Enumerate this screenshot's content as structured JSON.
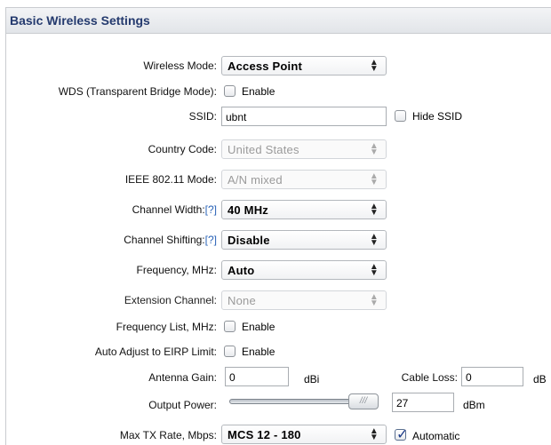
{
  "panel": {
    "title": "Basic Wireless Settings"
  },
  "wireless_mode": {
    "label": "Wireless Mode:",
    "value": "Access Point"
  },
  "wds": {
    "label": "WDS (Transparent Bridge Mode):",
    "checkbox_label": "Enable",
    "checked": false
  },
  "ssid": {
    "label": "SSID:",
    "value": "ubnt",
    "hide_label": "Hide SSID",
    "hide_checked": false
  },
  "country_code": {
    "label": "Country Code:",
    "value": "United States"
  },
  "ieee_mode": {
    "label": "IEEE 802.11 Mode:",
    "value": "A/N mixed"
  },
  "channel_width": {
    "label": "Channel Width:",
    "help": "[?]",
    "value": "40 MHz"
  },
  "channel_shifting": {
    "label": "Channel Shifting:",
    "help": "[?]",
    "value": "Disable"
  },
  "frequency": {
    "label": "Frequency, MHz:",
    "value": "Auto"
  },
  "extension_channel": {
    "label": "Extension Channel:",
    "value": "None"
  },
  "frequency_list": {
    "label": "Frequency List, MHz:",
    "checkbox_label": "Enable",
    "checked": false
  },
  "auto_adjust": {
    "label": "Auto Adjust to EIRP Limit:",
    "checkbox_label": "Enable",
    "checked": false
  },
  "antenna_gain": {
    "label": "Antenna Gain:",
    "value": "0",
    "unit": "dBi"
  },
  "cable_loss": {
    "label": "Cable Loss:",
    "value": "0",
    "unit": "dB"
  },
  "output_power": {
    "label": "Output Power:",
    "value": "27",
    "unit": "dBm",
    "slider_level": 1.0
  },
  "max_tx_rate": {
    "label": "Max TX Rate, Mbps:",
    "value": "MCS 12 - 180",
    "auto_label": "Automatic",
    "auto_checked": true
  },
  "icons": {
    "select_arrow": "updown-arrows-icon",
    "checkmark": "checkmark-icon",
    "slider_grip": "grip-icon"
  },
  "colors": {
    "title": "#243a6e",
    "help_link": "#2a63b7",
    "header_bg": "#e6e9ec"
  }
}
